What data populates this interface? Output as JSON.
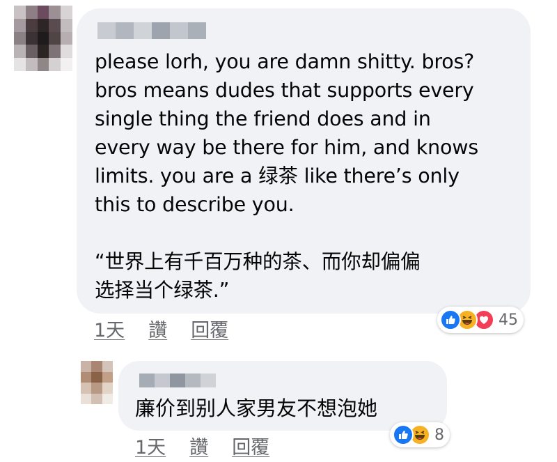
{
  "comments": [
    {
      "author_name": "",
      "text": "please lorh, you are damn shitty. bros?\nbros means dudes that supports every\nsingle thing the friend does and in\nevery way be there for him, and knows\nlimits. you are a 绿茶 like there’s only\nthis to describe you.\n\n“世界上有千百万种的茶、而你却偏偏\n选择当个绿茶.”",
      "time": "1天",
      "like_label": "讚",
      "reply_label": "回覆",
      "reaction_icons": [
        "like-icon",
        "haha-icon",
        "love-icon"
      ],
      "reaction_count": "45"
    },
    {
      "author_name": "",
      "text": "廉价到别人家男友不想泡她",
      "time": "1天",
      "like_label": "讚",
      "reply_label": "回覆",
      "reaction_icons": [
        "like-icon",
        "haha-icon"
      ],
      "reaction_count": "8"
    }
  ],
  "colors": {
    "bubble": "#f0f2f5",
    "meta_text": "#65676b",
    "like": "#1877f2",
    "haha": "#f7b125",
    "love": "#f33e58"
  }
}
